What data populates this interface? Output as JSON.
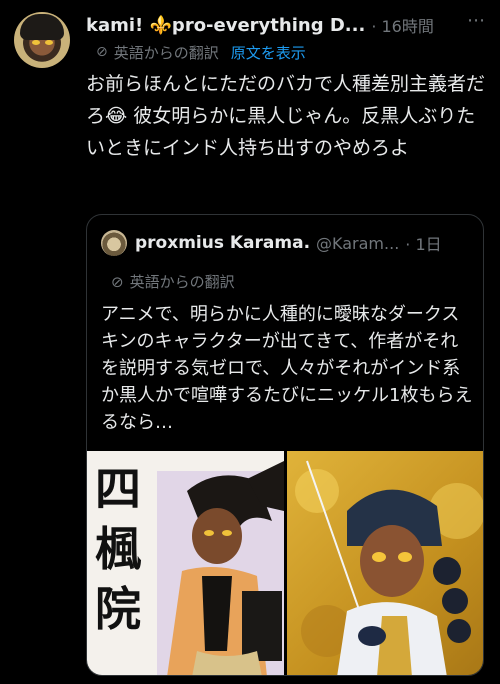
{
  "tweet": {
    "display_name": "kami! ⚜️pro-everything D...",
    "time": "· 16時間",
    "translation_label": "英語からの翻訳",
    "show_original": "原文を表示",
    "text": "お前らほんとにただのバカで人種差別主義者だろ😂 彼女明らかに黒人じゃん。反黒人ぶりたいときにインド人持ち出すのやめろよ",
    "more_icon": "more-dots-icon"
  },
  "quote": {
    "display_name": "proxmius Karama.",
    "handle": "@Karam...",
    "time": "· 1日",
    "translation_label": "英語からの翻訳",
    "text": "アニメで、明らかに人種的に曖昧なダークスキンのキャラクターが出てきて、作者がそれを説明する気ゼロで、人々がそれがインド系か黒人かで喧嘩するたびにニッケル1枚もらえるなら…"
  },
  "media": {
    "left_kanji": [
      "四",
      "楓",
      "院"
    ]
  },
  "colors": {
    "background": "#000000",
    "text": "#e7e9ea",
    "muted": "#71767b",
    "link": "#1d9bf0",
    "border": "#2f3336"
  }
}
